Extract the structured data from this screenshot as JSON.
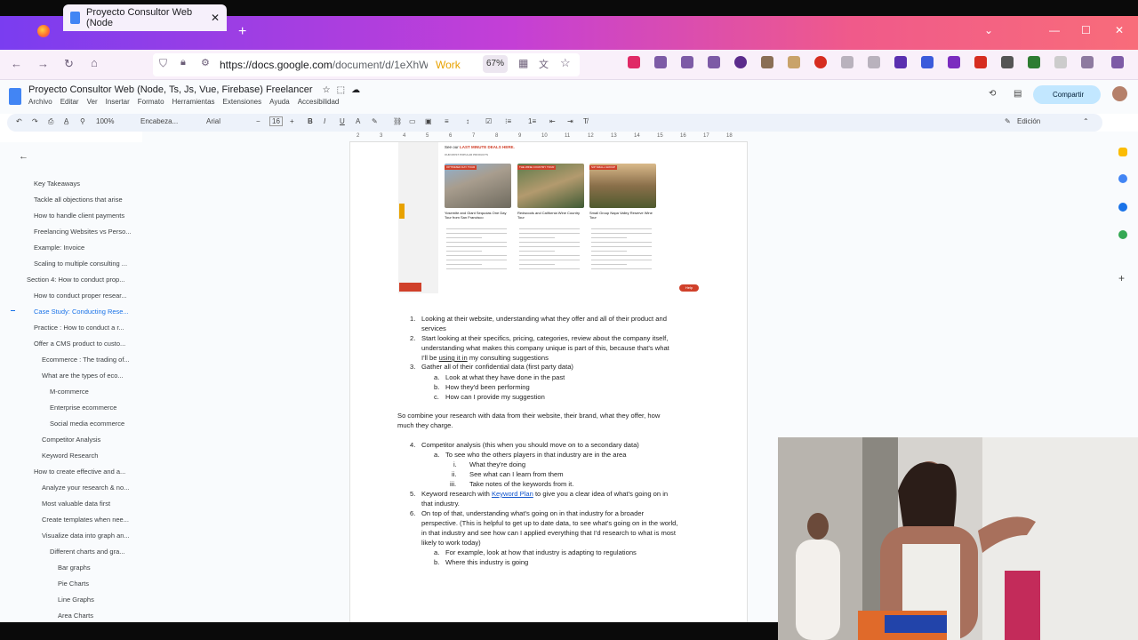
{
  "browser": {
    "tab_title": "Proyecto Consultor Web (Node",
    "url_host": "https://docs.google.com",
    "url_path": "/document/d/1eXhW",
    "work_label": "Work",
    "zoom": "67%"
  },
  "doc": {
    "title": "Proyecto Consultor Web (Node, Ts, Js, Vue, Firebase) Freelancer",
    "menu": [
      "Archivo",
      "Editar",
      "Ver",
      "Insertar",
      "Formato",
      "Herramientas",
      "Extensiones",
      "Ayuda",
      "Accesibilidad"
    ],
    "share_label": "Compartir",
    "toolbar": {
      "zoom": "100%",
      "style": "Encabeza...",
      "font": "Arial",
      "size": "16",
      "mode": "Edición"
    }
  },
  "outline": [
    {
      "label": "Key Takeaways",
      "level": 1
    },
    {
      "label": "Tackle all objections that arise",
      "level": 1
    },
    {
      "label": "How to handle client payments",
      "level": 1
    },
    {
      "label": "Freelancing Websites vs Perso...",
      "level": 1
    },
    {
      "label": "Example: Invoice",
      "level": 1
    },
    {
      "label": "Scaling to multiple consulting ...",
      "level": 1
    },
    {
      "label": "Section 4: How to conduct prop...",
      "level": 0
    },
    {
      "label": "How to conduct proper resear...",
      "level": 1
    },
    {
      "label": "Case Study: Conducting Rese...",
      "level": 1,
      "active": true
    },
    {
      "label": "Practice : How to conduct a r...",
      "level": 1
    },
    {
      "label": "Offer a CMS product to custo...",
      "level": 1
    },
    {
      "label": "Ecommerce : The trading of...",
      "level": 2
    },
    {
      "label": "What are the types of eco...",
      "level": 2
    },
    {
      "label": "M-commerce",
      "level": 3
    },
    {
      "label": "Enterprise ecommerce",
      "level": 3
    },
    {
      "label": "Social media ecommerce",
      "level": 3
    },
    {
      "label": "Competitor Analysis",
      "level": 2
    },
    {
      "label": "Keyword Research",
      "level": 2
    },
    {
      "label": "How to create effective and a...",
      "level": 1
    },
    {
      "label": "Analyze your research & no...",
      "level": 2
    },
    {
      "label": "Most valuable data first",
      "level": 2
    },
    {
      "label": "Create templates when nee...",
      "level": 2
    },
    {
      "label": "Visualize data into graph an...",
      "level": 2
    },
    {
      "label": "Different charts and gra...",
      "level": 3
    },
    {
      "label": "Bar graphs",
      "level": 4
    },
    {
      "label": "Pie Charts",
      "level": 4
    },
    {
      "label": "Line Graphs",
      "level": 4
    },
    {
      "label": "Area Charts",
      "level": 4
    }
  ],
  "embedded": {
    "heading_prefix": "See our",
    "heading_highlight": "LAST MINUTE DEALS HERE.",
    "subheading": "OUR MOST POPULAR PRODUCTS",
    "cards": [
      {
        "tag": "OPTIMIZED DAY TOUR",
        "title": "Yosemite and Giant Sequoias One Day Tour from San Francisco"
      },
      {
        "tag": "THE WINE COUNTRY TOUR",
        "title": "Redwoods and California Wine Country Tour"
      },
      {
        "tag": "SIP SMALL GROUP",
        "title": "Small Group Napa Valley Reserve Wine Tour"
      }
    ],
    "help": "Help"
  },
  "body": {
    "l1": "1.",
    "p1a": "Looking at their website, understanding what they offer and all of their product and",
    "p1b": "services",
    "l2": "2.",
    "p2a": "Start looking at their specifics, pricing, categories, review about the company itself,",
    "p2b": "understanding what makes this company unique is part of this, because that's what",
    "p2c1": "I'll be",
    "p2c2": "using it in",
    "p2c3": "my consulting suggestions",
    "l3": "3.",
    "p3": "Gather all of their confidential data (first party data)",
    "la": "a.",
    "p3a": "Look at what they have done in the past",
    "lb": "b.",
    "p3b": "How they'd been performing",
    "lc": "c.",
    "p3c": "How can I provide my suggestion",
    "combine1": "So combine your research with data from their website, their brand, what they offer, how",
    "combine2": "much they charge.",
    "l4": "4.",
    "p4": "Competitor analysis (this when you should move on to a secondary data)",
    "p4a": "To see who the others players in that industry are in the area",
    "li": "i.",
    "p4i": "What they're doing",
    "lii": "ii.",
    "p4ii": "See what can I learn from them",
    "liii": "iii.",
    "p4iii": "Take notes of the keywords from it.",
    "l5": "5.",
    "p5a": "Keyword research with",
    "p5link": "Keyword Plan",
    "p5b": "to give you a clear idea of what's going on in",
    "p5c": "that industry.",
    "l6": "6.",
    "p6a": "On top of that, understanding what's going on in that industry for a broader",
    "p6b": "perspective. (This is helpful to get up to date data, to see what's going on in the world,",
    "p6c": "in that industry and see how can I applied everything that I'd research to what is most",
    "p6d": "likely to work today)",
    "p6ea": "For example, look at how that industry is adapting to regulations",
    "p6eb": "Where this industry is going"
  }
}
